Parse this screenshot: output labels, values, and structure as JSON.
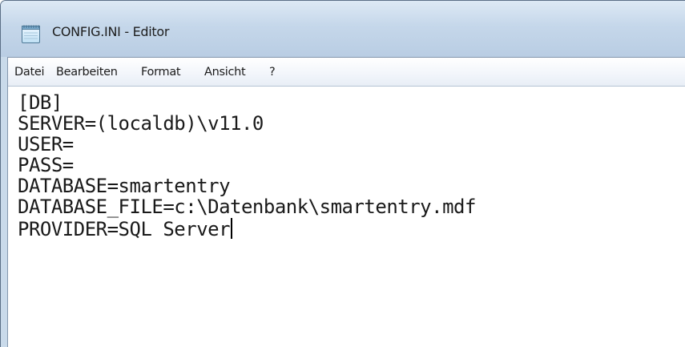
{
  "window": {
    "title": "CONFIG.INI - Editor",
    "icon": "notepad-icon"
  },
  "menu": {
    "items": [
      "Datei",
      "Bearbeiten",
      "Format",
      "Ansicht",
      "?"
    ]
  },
  "editor": {
    "lines": [
      "[DB]",
      "SERVER=(localdb)\\v11.0",
      "USER=",
      "PASS=",
      "DATABASE=smartentry",
      "DATABASE_FILE=c:\\Datenbank\\smartentry.mdf",
      "PROVIDER=SQL Server"
    ],
    "caret_line": 7
  }
}
